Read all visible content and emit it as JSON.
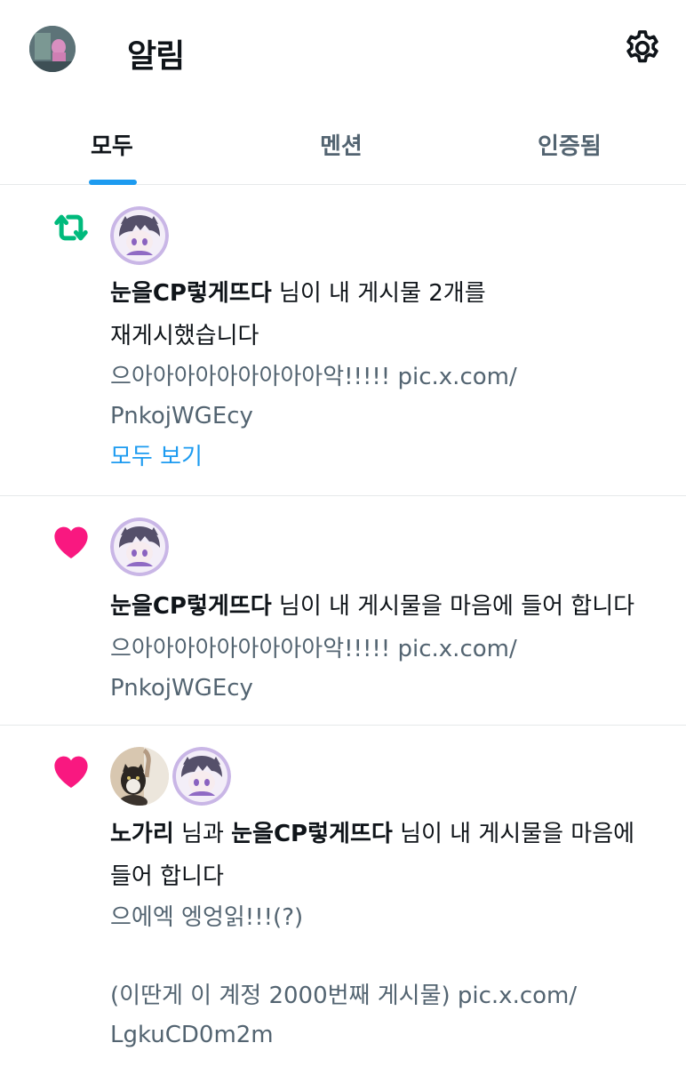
{
  "header": {
    "title": "알림",
    "avatar_icon": "user-avatar",
    "settings_icon": "gear-icon"
  },
  "tabs": [
    {
      "label": "모두",
      "active": true
    },
    {
      "label": "멘션",
      "active": false
    },
    {
      "label": "인증됨",
      "active": false
    }
  ],
  "accent_color": "#1d9bf0",
  "notifications": [
    {
      "type_icon": "repost-icon",
      "type_color": "#00ba7c",
      "user": "눈을CP렇게뜨다",
      "action_line1": " 님이 내 게시물 2개를",
      "action_line2": "재게시했습니다",
      "snippet_line1": "으아아아아아아아아아악!!!!! pic.x.com/",
      "snippet_line2": "PnkojWGEcy",
      "show_all": "모두 보기"
    },
    {
      "type_icon": "heart-icon",
      "type_color": "#f91880",
      "user": "눈을CP렇게뜨다",
      "action_line1": " 님이 내 게시물을 마음에 들어 합니다",
      "snippet_line1": "으아아아아아아아아아악!!!!! pic.x.com/",
      "snippet_line2": "PnkojWGEcy"
    },
    {
      "type_icon": "heart-icon",
      "type_color": "#f91880",
      "user1": "노가리",
      "connector": " 님과 ",
      "user2": "눈을CP렇게뜨다",
      "action_line1": " 님이 내 게시물을 마음에",
      "action_line2": "들어 합니다",
      "snippet_line1": "으에엑 엥엉읽!!!(?)",
      "snippet_line2": "(이딴게 이 계정 2000번째 게시물) pic.x.com/",
      "snippet_line3": "LgkuCD0m2m"
    }
  ]
}
